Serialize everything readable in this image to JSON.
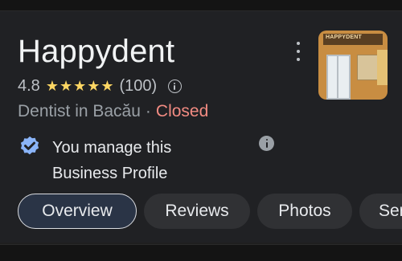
{
  "business": {
    "name": "Happydent",
    "rating": "4.8",
    "star_count": 5,
    "reviews_count": "(100)",
    "category": "Dentist in Bacău",
    "separator": "·",
    "status": "Closed"
  },
  "thumbnail": {
    "sign_text": "HAPPYDENT"
  },
  "manage": {
    "line1": "You manage this",
    "line2": "Business Profile"
  },
  "tabs": [
    {
      "label": "Overview",
      "active": true
    },
    {
      "label": "Reviews",
      "active": false
    },
    {
      "label": "Photos",
      "active": false
    },
    {
      "label": "Ser",
      "active": false
    }
  ],
  "colors": {
    "star": "#fdd663",
    "closed": "#f28b82",
    "verified": "#8ab4f8",
    "background": "#202124"
  },
  "icons": {
    "rating_info": "info-outline-icon",
    "manage_info": "info-filled-icon",
    "verified": "verified-badge-icon",
    "menu": "more-vert-icon"
  }
}
